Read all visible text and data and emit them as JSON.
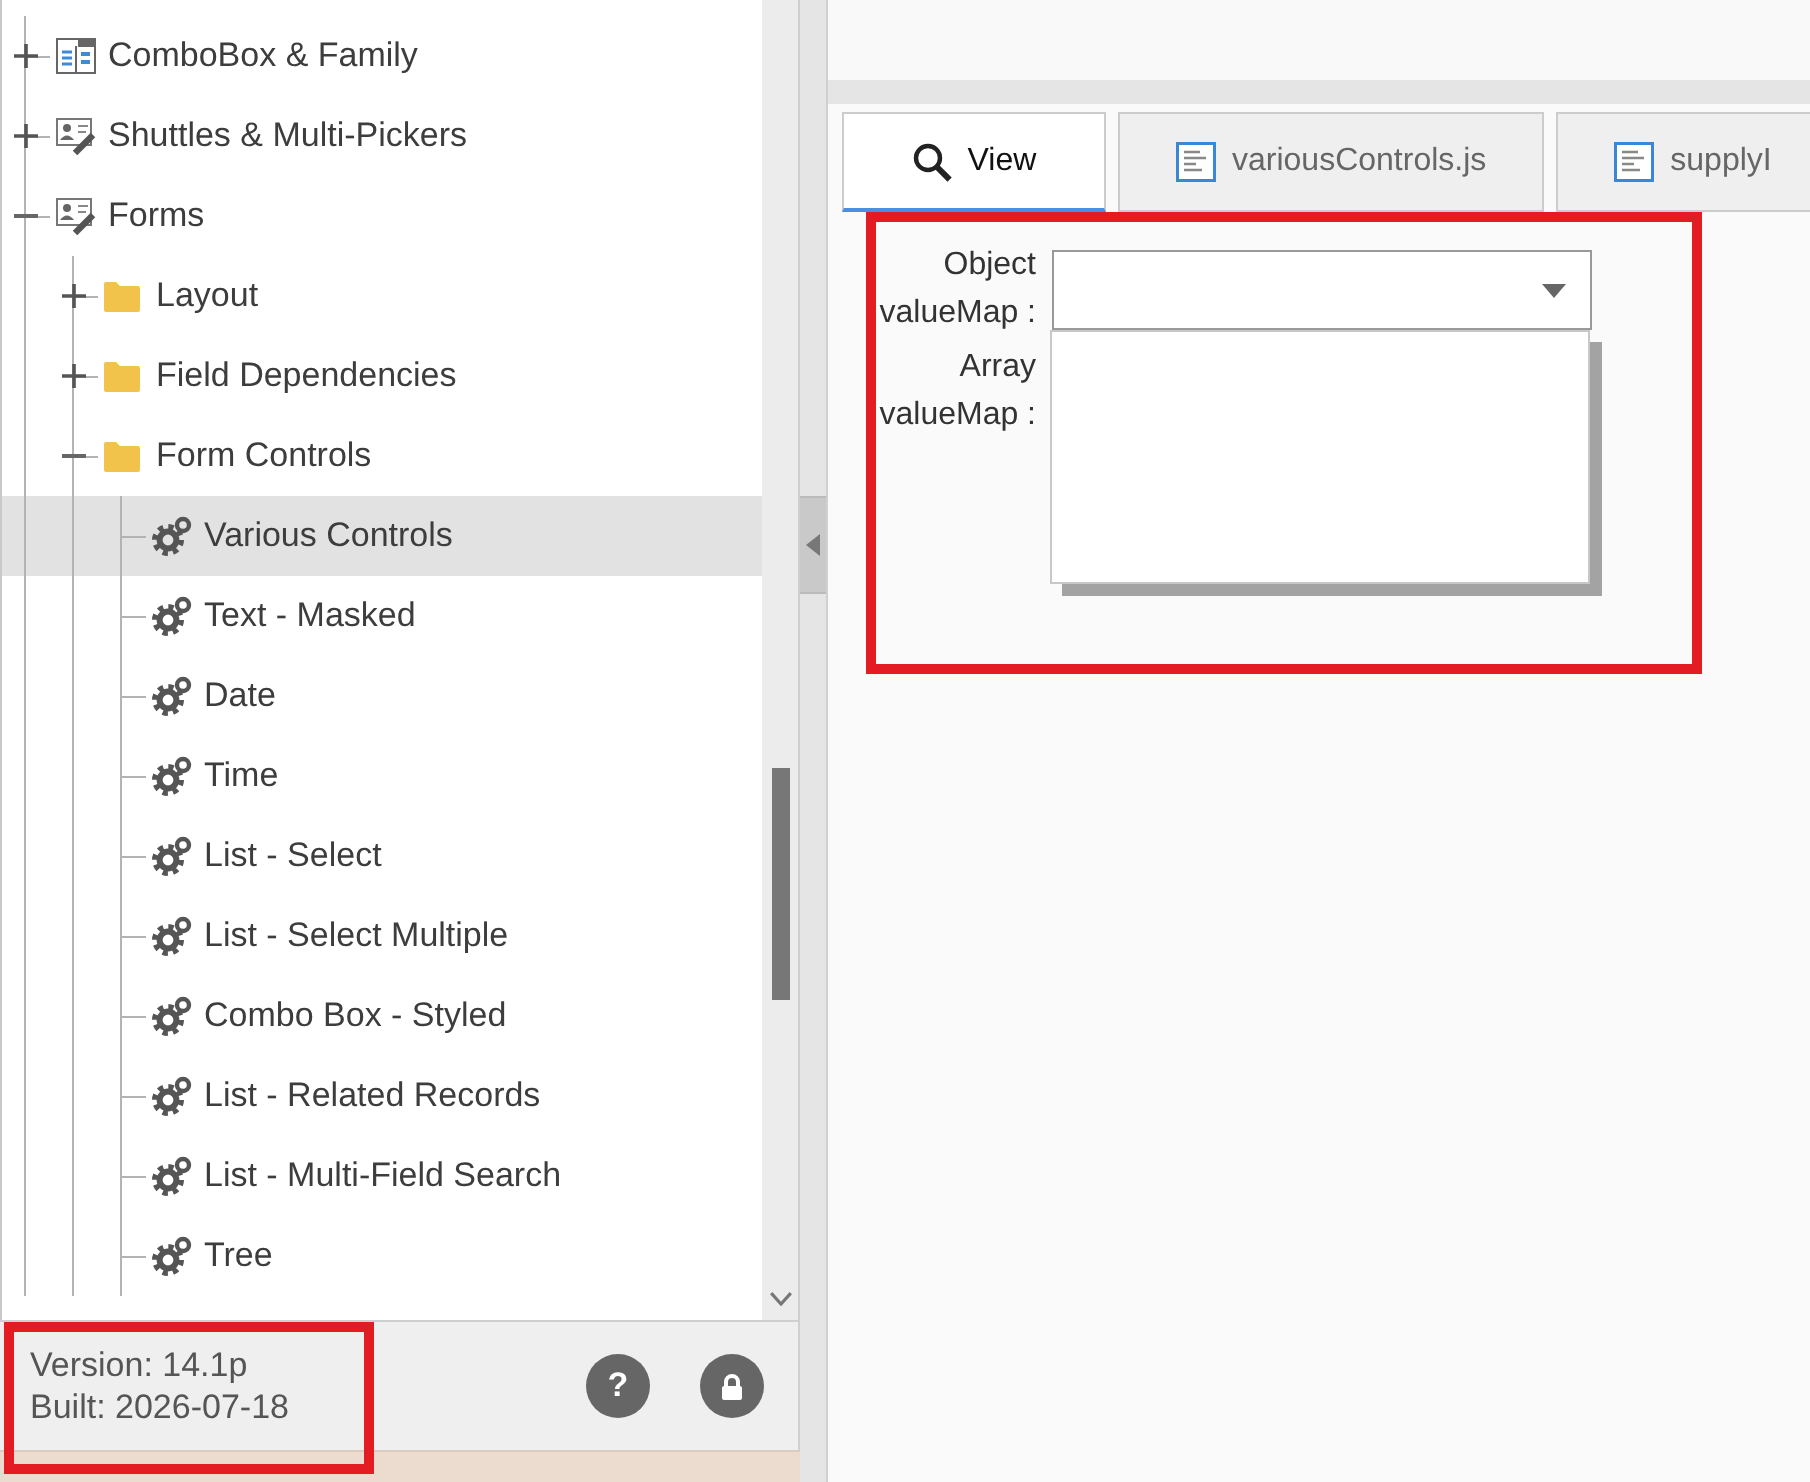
{
  "tree": {
    "items": [
      {
        "label": "ComboBox & Family",
        "kind": "combo",
        "expanded": false,
        "selected": false
      },
      {
        "label": "Shuttles & Multi-Pickers",
        "kind": "editor",
        "expanded": false,
        "selected": false
      },
      {
        "label": "Forms",
        "kind": "editor",
        "expanded": true,
        "selected": false,
        "children": [
          {
            "label": "Layout",
            "kind": "folder",
            "expanded": false,
            "selected": false
          },
          {
            "label": "Field Dependencies",
            "kind": "folder",
            "expanded": false,
            "selected": false
          },
          {
            "label": "Form Controls",
            "kind": "folder",
            "expanded": true,
            "selected": false,
            "children": [
              {
                "label": "Various Controls",
                "kind": "sample",
                "selected": true
              },
              {
                "label": "Text - Masked",
                "kind": "sample",
                "selected": false
              },
              {
                "label": "Date",
                "kind": "sample",
                "selected": false
              },
              {
                "label": "Time",
                "kind": "sample",
                "selected": false
              },
              {
                "label": "List - Select",
                "kind": "sample",
                "selected": false
              },
              {
                "label": "List - Select Multiple",
                "kind": "sample",
                "selected": false
              },
              {
                "label": "Combo Box - Styled",
                "kind": "sample",
                "selected": false
              },
              {
                "label": "List - Related Records",
                "kind": "sample",
                "selected": false
              },
              {
                "label": "List - Multi-Field Search",
                "kind": "sample",
                "selected": false
              },
              {
                "label": "Tree",
                "kind": "sample",
                "selected": false
              }
            ]
          }
        ]
      }
    ]
  },
  "footer": {
    "version": "Version: 14.1p",
    "built": "Built: 2026-07-18",
    "help_label": "?"
  },
  "tabs": [
    {
      "label": "View",
      "kind": "view",
      "selected": true
    },
    {
      "label": "variousControls.js",
      "kind": "file",
      "selected": false
    },
    {
      "label": "supplyI",
      "kind": "file",
      "selected": false
    }
  ],
  "form": {
    "fields": [
      {
        "label": "Object valueMap :",
        "kind": "select",
        "expanded": true
      },
      {
        "label": "Array valueMap :",
        "kind": "label"
      }
    ]
  }
}
